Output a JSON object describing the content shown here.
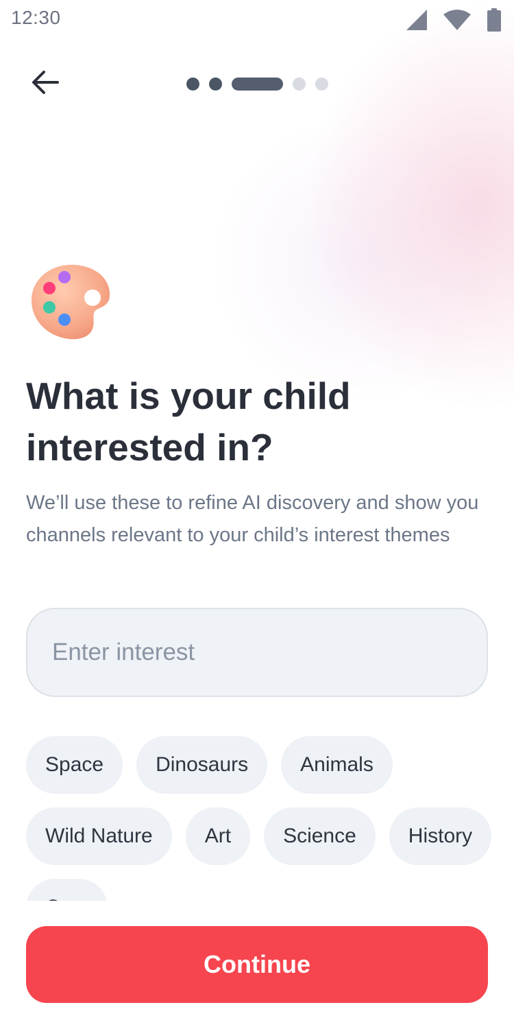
{
  "status_bar": {
    "time": "12:30",
    "icons": [
      "signal-icon",
      "wifi-icon",
      "battery-icon"
    ]
  },
  "header": {
    "back_icon": "arrow-left-icon",
    "progress": {
      "total_steps": 5,
      "current_step": 3
    }
  },
  "hero": {
    "icon": "artist-palette-icon",
    "title": "What is your child interested in?",
    "subtitle": "We’ll use these to refine AI discovery and show you channels relevant to your child’s interest themes"
  },
  "interest_input": {
    "value": "",
    "placeholder": "Enter interest"
  },
  "chips": [
    {
      "label": "Space"
    },
    {
      "label": "Dinosaurs"
    },
    {
      "label": "Animals"
    },
    {
      "label": "Wild Nature"
    },
    {
      "label": "Art"
    },
    {
      "label": "Science"
    },
    {
      "label": "History"
    },
    {
      "label": "Cars"
    }
  ],
  "footer": {
    "continue_label": "Continue"
  },
  "colors": {
    "accent": "#f6454f",
    "title_text": "#2a2f39",
    "subtitle_text": "#6b7687",
    "chip_bg": "#eef1f5",
    "progress_active": "#555e6e",
    "progress_upcoming": "#d8dbe2"
  }
}
